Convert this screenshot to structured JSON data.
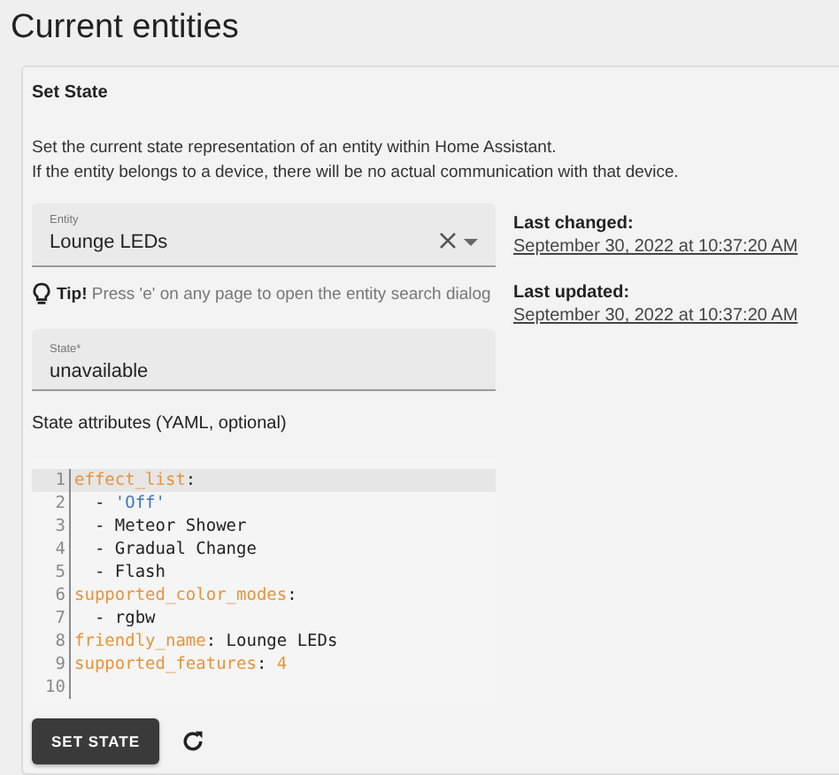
{
  "page_title": "Current entities",
  "card": {
    "title": "Set State",
    "description": [
      "Set the current state representation of an entity within Home Assistant.",
      "If the entity belongs to a device, there will be no actual communication with that device."
    ],
    "entity_field": {
      "label": "Entity",
      "value": "Lounge LEDs"
    },
    "tip": "**Tip!** Press 'e' on any page to open the entity search dialog",
    "state_field": {
      "label": "State*",
      "value": "unavailable"
    },
    "attributes_label": "State attributes (YAML, optional)",
    "code_lines": [
      {
        "number": "1",
        "active": true,
        "tokens": [
          {
            "kind": "key",
            "text": "effect_list"
          },
          {
            "kind": "plain",
            "text": ":"
          }
        ]
      },
      {
        "number": "2",
        "active": false,
        "tokens": [
          {
            "kind": "plain",
            "text": "  - "
          },
          {
            "kind": "string",
            "text": "'Off'"
          }
        ]
      },
      {
        "number": "3",
        "active": false,
        "tokens": [
          {
            "kind": "plain",
            "text": "  - Meteor Shower"
          }
        ]
      },
      {
        "number": "4",
        "active": false,
        "tokens": [
          {
            "kind": "plain",
            "text": "  - Gradual Change"
          }
        ]
      },
      {
        "number": "5",
        "active": false,
        "tokens": [
          {
            "kind": "plain",
            "text": "  - Flash"
          }
        ]
      },
      {
        "number": "6",
        "active": false,
        "tokens": [
          {
            "kind": "key",
            "text": "supported_color_modes"
          },
          {
            "kind": "plain",
            "text": ":"
          }
        ]
      },
      {
        "number": "7",
        "active": false,
        "tokens": [
          {
            "kind": "plain",
            "text": "  - rgbw"
          }
        ]
      },
      {
        "number": "8",
        "active": false,
        "tokens": [
          {
            "kind": "key",
            "text": "friendly_name"
          },
          {
            "kind": "plain",
            "text": ": Lounge LEDs"
          }
        ]
      },
      {
        "number": "9",
        "active": false,
        "tokens": [
          {
            "kind": "key",
            "text": "supported_features"
          },
          {
            "kind": "plain",
            "text": ": "
          },
          {
            "kind": "number",
            "text": "4"
          }
        ]
      },
      {
        "number": "10",
        "active": false
      }
    ],
    "set_button": "SET STATE",
    "last_changed": {
      "label": "Last changed:",
      "value": "September 30, 2022 at 10:37:20 AM"
    },
    "last_updated": {
      "label": "Last updated:",
      "value": "September 30, 2022 at 10:37:20 AM"
    }
  }
}
